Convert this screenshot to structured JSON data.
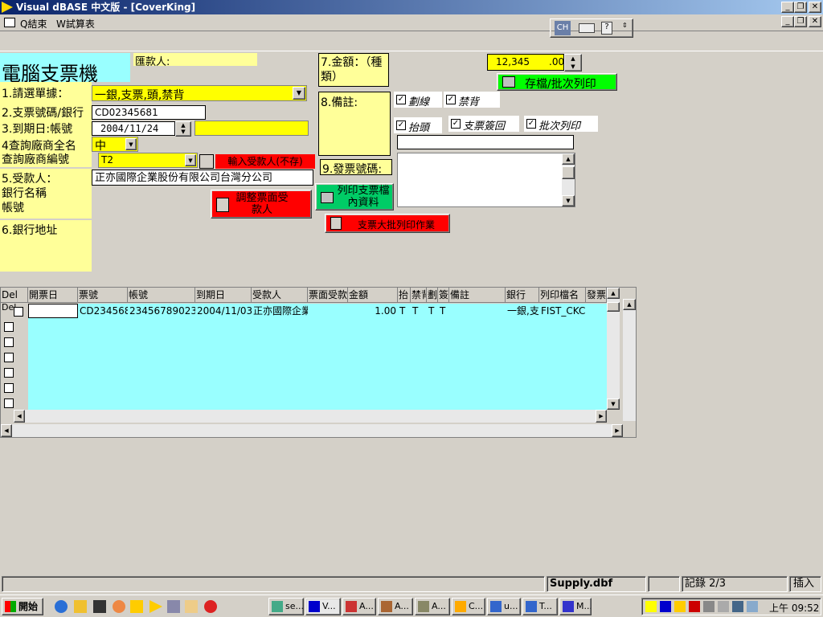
{
  "window": {
    "title": "Visual dBASE 中文版 - [CoverKing]"
  },
  "menu": {
    "quit": "Q結束",
    "trial": "W試算表"
  },
  "toolbar": {
    "ch_label": "CH"
  },
  "form": {
    "app_title": "電腦支票機",
    "payee_label": "匯款人:",
    "l1": "1.請選單據：",
    "l1_value": "一銀,支票,頭,禁背",
    "l2": "2.支票號碼/銀行",
    "l2_value": "CD02345681",
    "l3": "3.到期日:帳號",
    "l3_value": "2004/11/24",
    "l4a": "4查詢廠商全名",
    "l4b": "查詢廠商編號",
    "l4_combo": "中",
    "l4_code": "T2",
    "btn_input_payee": "輸入受款人(不存)",
    "l5a": "5.受款人：",
    "l5b": "銀行名稱",
    "l5c": "帳號",
    "l5_value": "正亦國際企業股份有限公司台灣分公司",
    "btn_adjust": "調整票面受款人",
    "l6": "6.銀行地址",
    "l7": "7.金額：（種類）",
    "amount_value": "12,345",
    "amount_cents": ".00",
    "btn_save_print": "存檔/批次列印",
    "l8": "8.備註:",
    "chk_cross": "劃線",
    "chk_noback": "禁背",
    "chk_head": "抬頭",
    "chk_return": "支票簽回",
    "chk_batch": "批次列印",
    "l9": "9.發票號碼:",
    "btn_print_check": "列印支票檔內資料",
    "btn_batch": "支票大批列印作業"
  },
  "grid": {
    "headers": [
      "Del",
      "開票日",
      "票號",
      "帳號",
      "到期日",
      "受款人",
      "票面受款",
      "金額",
      "抬",
      "禁背",
      "劃",
      "簽",
      "備註",
      "銀行",
      "列印檔名",
      "發票"
    ],
    "row_label": "Del",
    "row1": [
      "",
      "CD234568",
      "23456789023",
      "2004/11/03",
      "正亦國際企業",
      "",
      "1.00",
      "T",
      "T",
      "T",
      "T",
      "",
      "一銀,支",
      "FIST_CKC"
    ]
  },
  "status": {
    "file": "Supply.dbf",
    "record": "記錄 2/3",
    "mode": "插入"
  },
  "taskbar": {
    "start": "開始",
    "tasks": [
      "se...",
      "V...",
      "A...",
      "A...",
      "A...",
      "C...",
      "u...",
      "T...",
      "M..."
    ],
    "clock": "上午 09:52"
  }
}
